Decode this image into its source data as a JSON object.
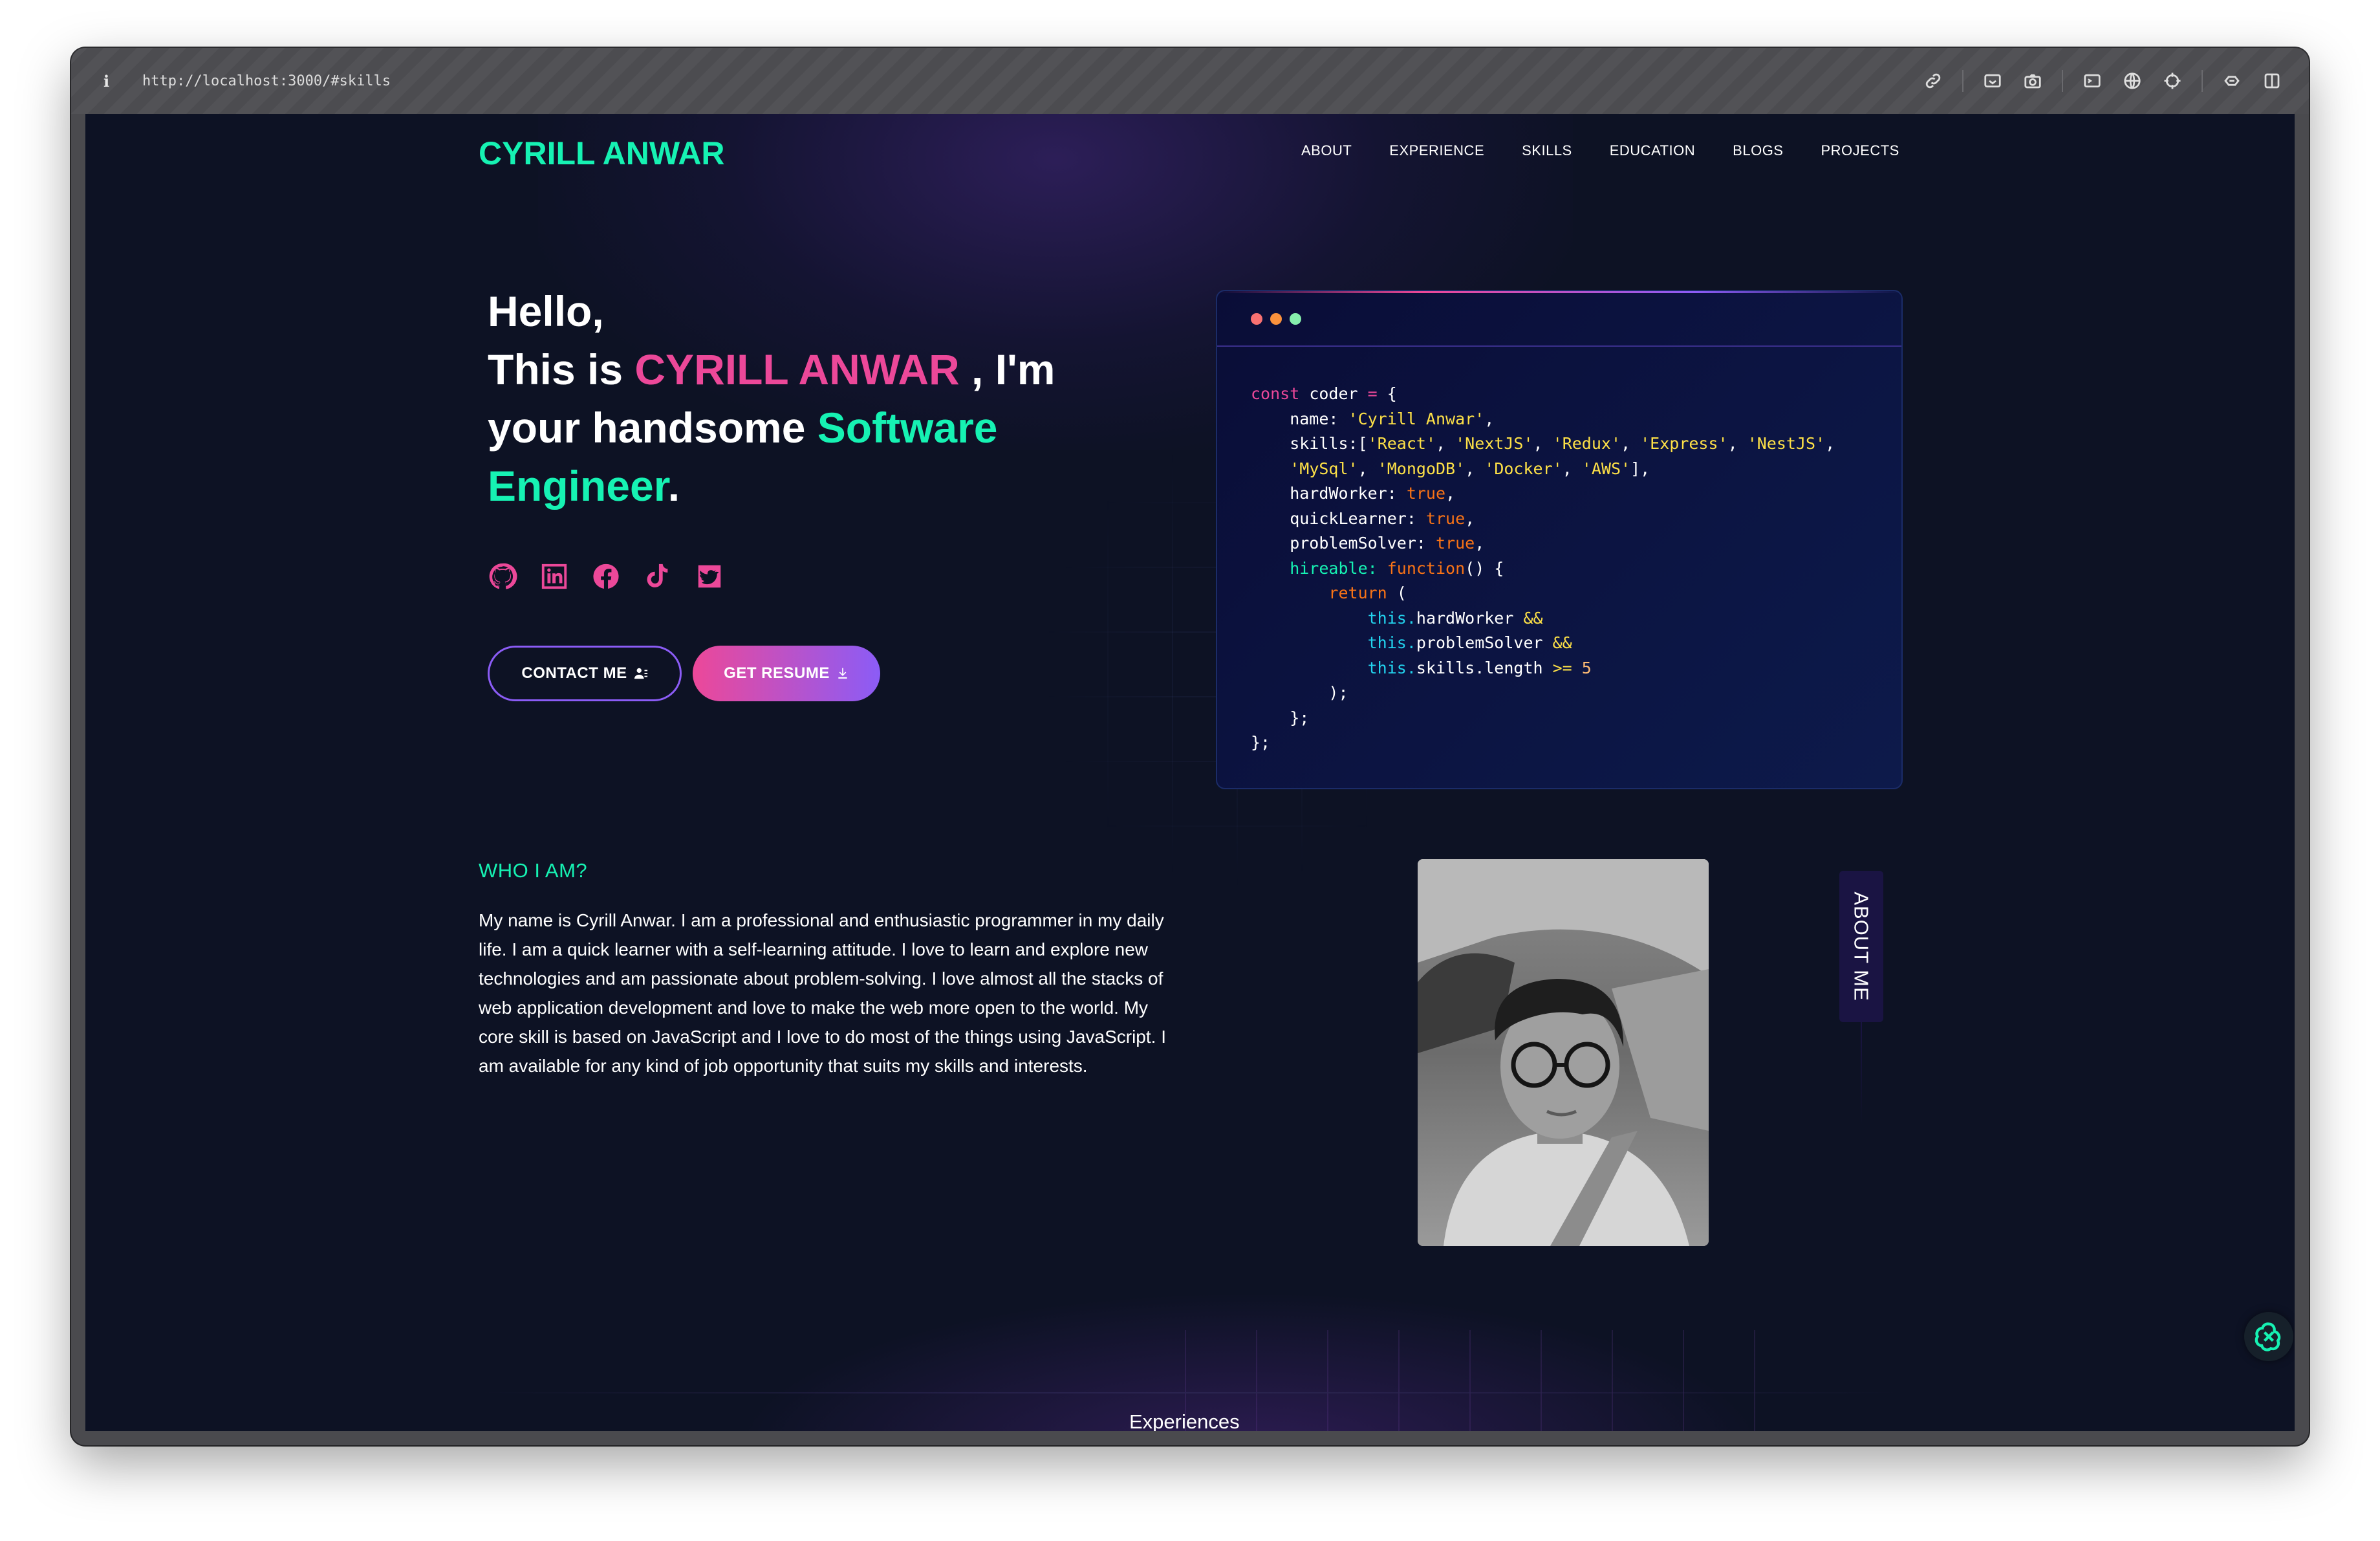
{
  "browser": {
    "info_label": "i",
    "url": "http://localhost:3000/#skills"
  },
  "nav": {
    "logo": "CYRILL ANWAR",
    "items": [
      {
        "label": "ABOUT"
      },
      {
        "label": "EXPERIENCE"
      },
      {
        "label": "SKILLS"
      },
      {
        "label": "EDUCATION"
      },
      {
        "label": "BLOGS"
      },
      {
        "label": "PROJECTS"
      }
    ]
  },
  "hero": {
    "line1": "Hello,",
    "this_is": "This is ",
    "name": "CYRILL ANWAR",
    "im": " , I'm",
    "your": "your handsome ",
    "role_word1": "Software",
    "role_word2": "Engineer",
    "period": "."
  },
  "socials": [
    "github-icon",
    "linkedin-icon",
    "facebook-icon",
    "tiktok-icon",
    "twitter-icon"
  ],
  "buttons": {
    "contact": "CONTACT ME",
    "resume": "GET RESUME"
  },
  "code_window": {
    "dot_colors": [
      "#f87171",
      "#fb923c",
      "#86efac"
    ],
    "lines": {
      "l1_kw": "const",
      "l1_rest": " coder ",
      "l1_op": "=",
      "l1_brace": " {",
      "l2_key": "    name: ",
      "l2_val": "'Cyrill Anwar'",
      "l2_end": ",",
      "l3_key": "    skills:",
      "l3_vals": [
        "'React'",
        "'NextJS'",
        "'Redux'",
        "'Express'",
        "'NestJS'"
      ],
      "l4_vals": [
        "'MySql'",
        "'MongoDB'",
        "'Docker'",
        "'AWS'"
      ],
      "l5_key": "    hardWorker: ",
      "l6_key": "    quickLearner: ",
      "l7_key": "    problemSolver: ",
      "bool_true": "true",
      "l8_key": "    hireable: ",
      "l8_fn": "function",
      "l8_rest": "() {",
      "l9_ret": "return",
      "l9_rest": " (",
      "l10_this": "this.",
      "l10_prop": "hardWorker ",
      "l10_op": "&&",
      "l11_prop": "problemSolver ",
      "l12_prop": "skills.length ",
      "l12_op": ">=",
      "l12_num": "5",
      "l13": "        );",
      "l14": "    };",
      "l15": "};"
    }
  },
  "about": {
    "heading": "WHO I AM?",
    "paragraph": "My name is Cyrill Anwar. I am a professional and enthusiastic programmer in my daily life. I am a quick learner with a self-learning attitude. I love to learn and explore new technologies and am passionate about problem-solving. I love almost all the stacks of web application development and love to make the web more open to the world. My core skill is based on JavaScript and I love to do most of the things using JavaScript. I am available for any kind of job opportunity that suits my skills and interests.",
    "tag": "ABOUT ME"
  },
  "experiences": {
    "title": "Experiences"
  },
  "colors": {
    "accent_green": "#16f2b3",
    "accent_pink": "#ec4899",
    "accent_violet": "#8b5cf6",
    "background": "#0d1224"
  }
}
